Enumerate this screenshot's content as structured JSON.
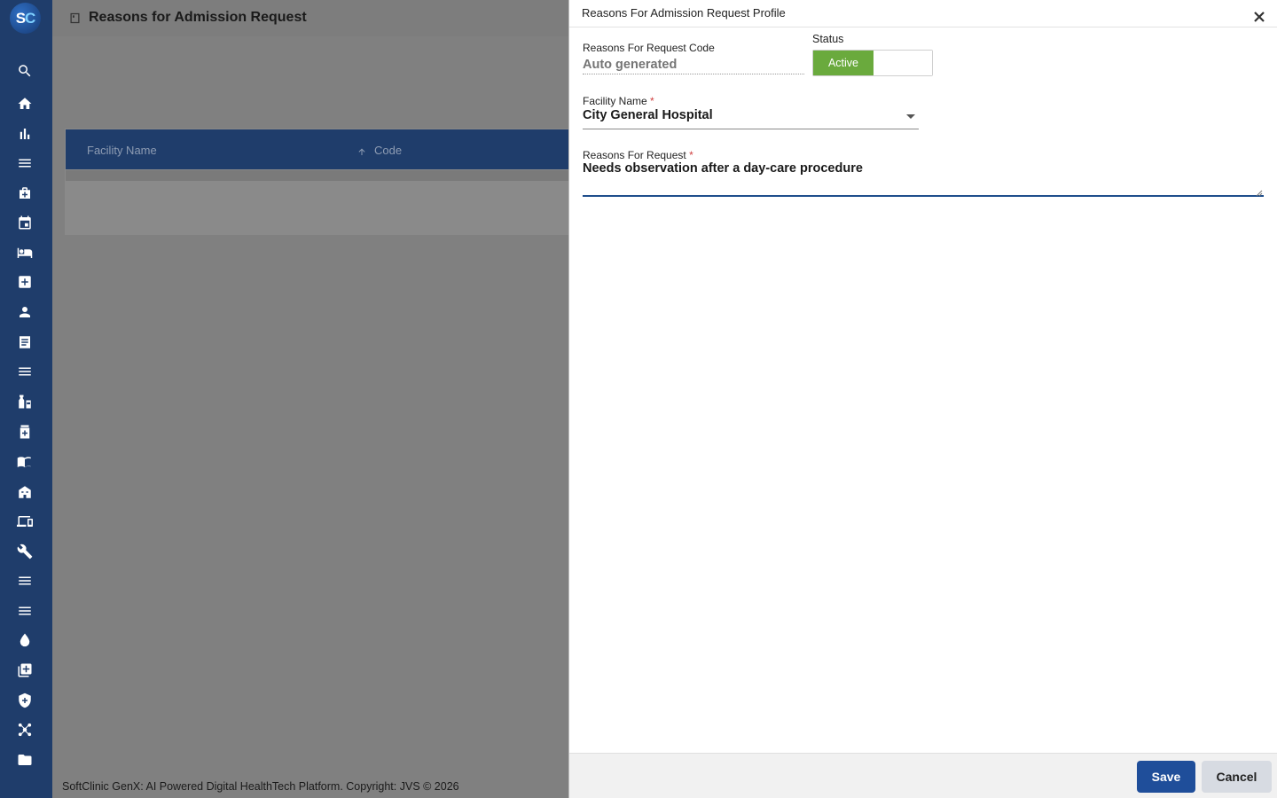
{
  "app": {
    "logo_s": "S",
    "logo_c": "C",
    "page_title": "Reasons for Admission Request",
    "footer": "SoftClinic GenX: AI Powered Digital HealthTech Platform. Copyright: JVS © 2026"
  },
  "table": {
    "columns": [
      "Facility Name",
      "Code"
    ]
  },
  "sidebar": {
    "icons": [
      "search-icon",
      "home-icon",
      "bar-chart-icon",
      "menu-icon",
      "medical-kit-icon",
      "calendar-icon",
      "bed-icon",
      "medical-cross-icon",
      "person-icon",
      "document-icon",
      "menu-icon",
      "medication-icon",
      "pharmacy-icon",
      "book-icon",
      "building-icon",
      "devices-icon",
      "wrench-icon",
      "menu-icon",
      "menu-icon",
      "blood-drop-icon",
      "add-library-icon",
      "shield-icon",
      "network-icon",
      "folder-icon"
    ]
  },
  "drawer": {
    "title": "Reasons For Admission Request Profile",
    "code_label": "Reasons For Request Code",
    "code_placeholder": "Auto generated",
    "status_label": "Status",
    "status_active": "Active",
    "facility_label": "Facility Name",
    "facility_value": "City General Hospital",
    "reason_label": "Reasons For Request",
    "reason_value": "Needs observation after a day-care procedure",
    "required_mark": "*",
    "save_label": "Save",
    "cancel_label": "Cancel"
  },
  "colors": {
    "sidebar": "#1f3d6b",
    "active_toggle": "#6aaa3d",
    "save_button": "#1f4e9a"
  }
}
